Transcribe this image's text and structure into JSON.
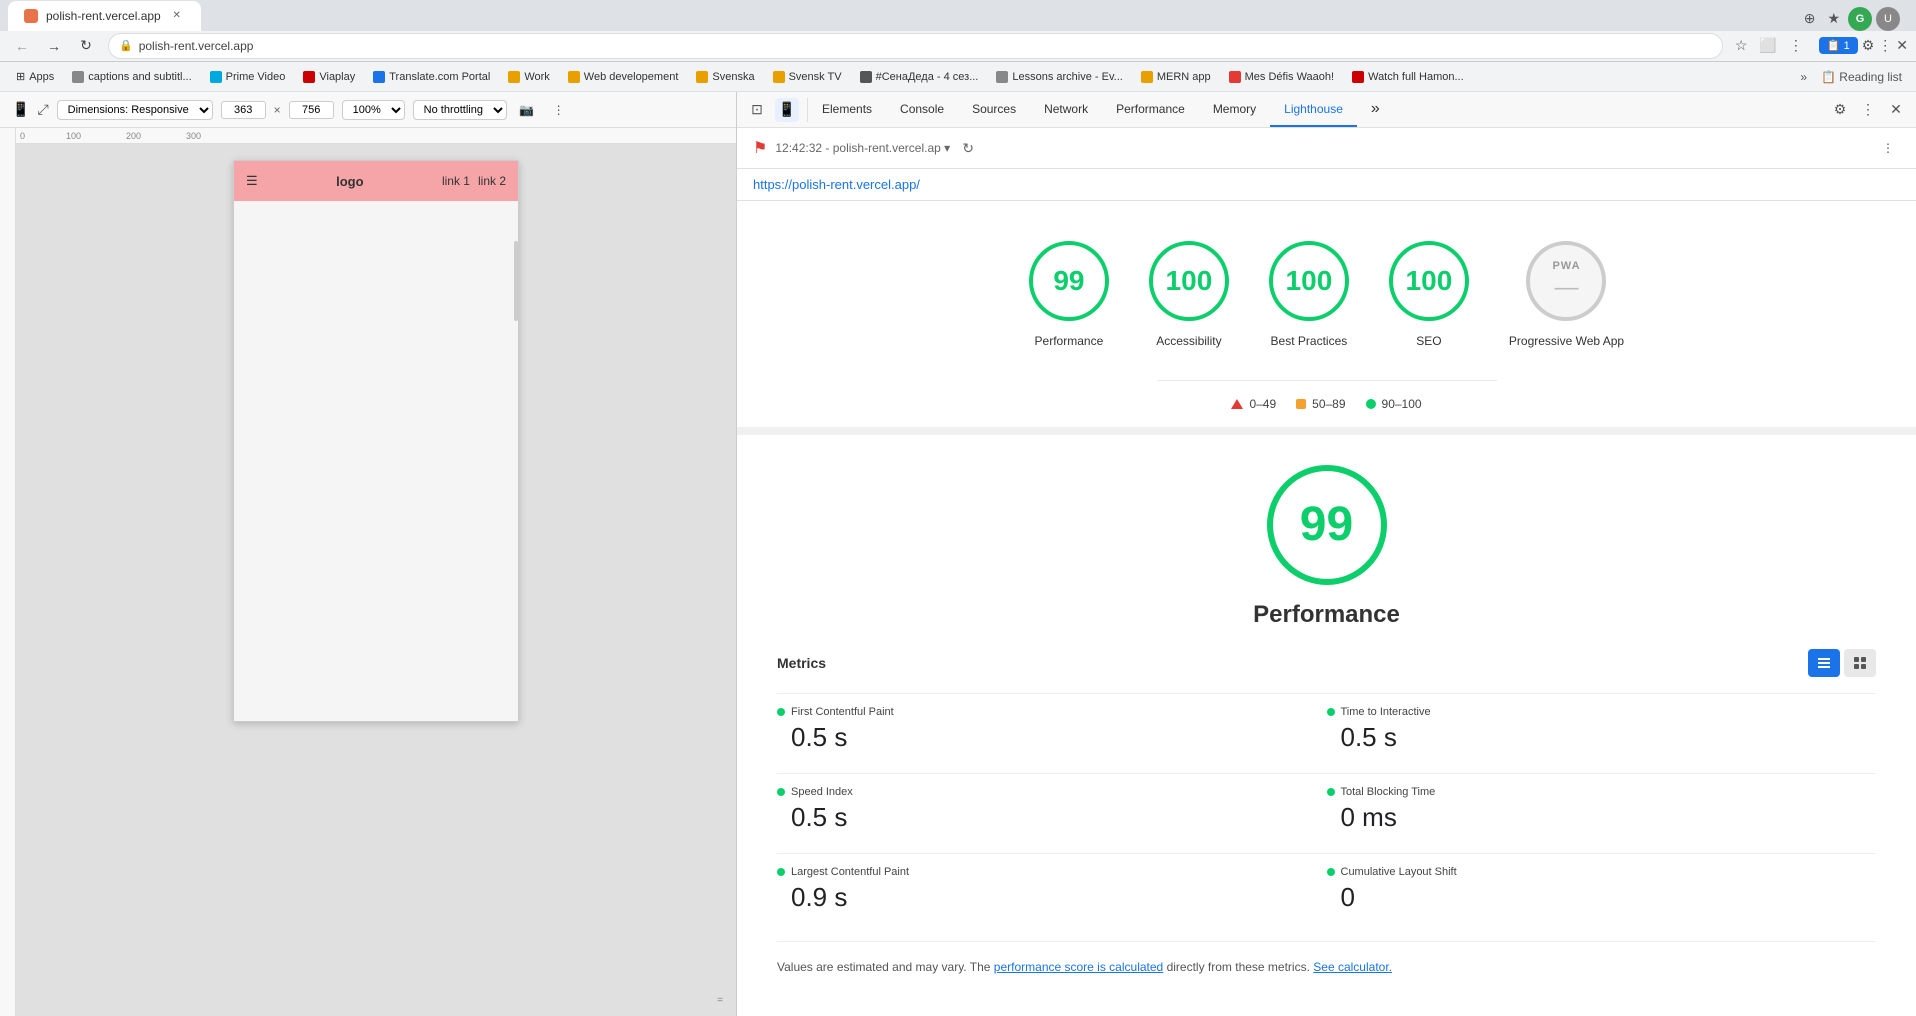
{
  "browser": {
    "tab_title": "polish-rent.vercel.app",
    "url": "polish-rent.vercel.app",
    "full_url": "https://polish-rent.vercel.app/",
    "back_btn": "←",
    "forward_btn": "→",
    "refresh_btn": "↻",
    "home_btn": "⌂"
  },
  "bookmarks": [
    {
      "label": "Apps",
      "id": "apps"
    },
    {
      "label": "captions and subtitl...",
      "id": "captions"
    },
    {
      "label": "Prime Video",
      "id": "prime-video"
    },
    {
      "label": "Viaplay",
      "id": "viaplay"
    },
    {
      "label": "Translate.com Portal",
      "id": "translate"
    },
    {
      "label": "Work",
      "id": "work"
    },
    {
      "label": "Web developement",
      "id": "webdev"
    },
    {
      "label": "Svenska",
      "id": "svenska"
    },
    {
      "label": "Svensk TV",
      "id": "svensk-tv"
    },
    {
      "label": "#СенаДеда - 4 сез...",
      "id": "sena"
    },
    {
      "label": "Lessons archive - Ev...",
      "id": "lessons"
    },
    {
      "label": "MERN app",
      "id": "mern"
    },
    {
      "label": "Mes Défis Waaoh!",
      "id": "defis"
    },
    {
      "label": "Watch full Hamon...",
      "id": "hamon"
    }
  ],
  "device_toolbar": {
    "device_label": "Dimensions: Responsive",
    "width": "363",
    "height": "756",
    "zoom": "100%",
    "throttle": "No throttling"
  },
  "preview": {
    "logo": "logo",
    "link1": "link 1",
    "link2": "link 2"
  },
  "devtools": {
    "tabs": [
      {
        "id": "elements",
        "label": "Elements"
      },
      {
        "id": "console",
        "label": "Console"
      },
      {
        "id": "sources",
        "label": "Sources"
      },
      {
        "id": "network",
        "label": "Network"
      },
      {
        "id": "performance",
        "label": "Performance"
      },
      {
        "id": "memory",
        "label": "Memory"
      },
      {
        "id": "lighthouse",
        "label": "Lighthouse"
      }
    ],
    "active_tab": "lighthouse"
  },
  "lighthouse": {
    "timestamp": "12:42:32",
    "url_display": "polish-rent.vercel.ap",
    "full_url": "https://polish-rent.vercel.app/",
    "scores": [
      {
        "id": "performance",
        "value": 99,
        "label": "Performance",
        "color": "green"
      },
      {
        "id": "accessibility",
        "value": 100,
        "label": "Accessibility",
        "color": "green"
      },
      {
        "id": "best-practices",
        "value": 100,
        "label": "Best Practices",
        "color": "green"
      },
      {
        "id": "seo",
        "value": 100,
        "label": "SEO",
        "color": "green"
      },
      {
        "id": "pwa",
        "value": "—",
        "label": "Progressive Web App",
        "color": "gray"
      }
    ],
    "legend": [
      {
        "type": "triangle",
        "range": "0–49"
      },
      {
        "type": "square",
        "range": "50–89"
      },
      {
        "type": "dot",
        "range": "90–100"
      }
    ],
    "perf_score": 99,
    "perf_title": "Performance",
    "metrics_title": "Metrics",
    "metrics": [
      {
        "id": "fcp",
        "name": "First Contentful Paint",
        "value": "0.5 s"
      },
      {
        "id": "tti",
        "name": "Time to Interactive",
        "value": "0.5 s"
      },
      {
        "id": "si",
        "name": "Speed Index",
        "value": "0.5 s"
      },
      {
        "id": "tbt",
        "name": "Total Blocking Time",
        "value": "0 ms"
      },
      {
        "id": "lcp",
        "name": "Largest Contentful Paint",
        "value": "0.9 s"
      },
      {
        "id": "cls",
        "name": "Cumulative Layout Shift",
        "value": "0"
      }
    ],
    "note_text": "Values are estimated and may vary. The",
    "note_link1": "performance score is calculated",
    "note_link1_suffix": " directly from these metrics.",
    "note_link2": "See calculator.",
    "view_btn_list": "≡",
    "view_btn_grid": "⊞"
  }
}
